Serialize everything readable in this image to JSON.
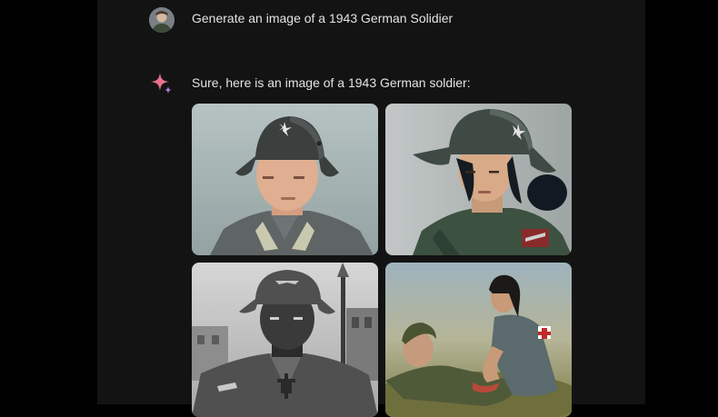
{
  "conversation": {
    "user_prompt": "Generate an image of a 1943 German Solidier",
    "assistant_reply": "Sure, here is an image of a 1943 German soldier:"
  },
  "icons": {
    "user_avatar": "user-avatar",
    "assistant": "sparkle-icon"
  },
  "colors": {
    "background": "#131313",
    "text": "#e3e3e3",
    "sparkle": "#e8718c"
  },
  "images": [
    {
      "name": "generated-image-1"
    },
    {
      "name": "generated-image-2"
    },
    {
      "name": "generated-image-3"
    },
    {
      "name": "generated-image-4"
    }
  ]
}
